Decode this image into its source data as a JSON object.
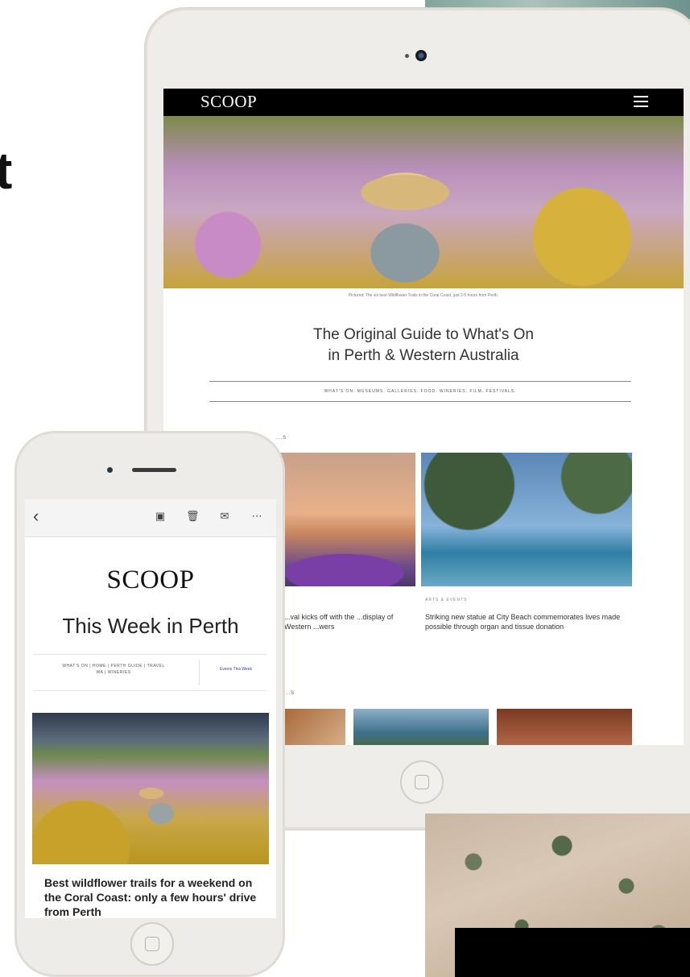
{
  "background": {
    "left_fragment": "t",
    "colors": {
      "ocean": "#7fa59c",
      "sand": "#d8c8b6",
      "black_box": "#000000"
    }
  },
  "tablet": {
    "nav": {
      "logo": "SCOOP",
      "menu_icon": "hamburger-icon"
    },
    "hero_caption": "Pictured: The six best Wildflower Trails in the Coral Coast, just 2-5 hours from Perth.",
    "heading_line1": "The Original Guide to What's On",
    "heading_line2": "in Perth & Western Australia",
    "categories": "WHAT'S ON. MUSEUMS. GALLERIES. FOOD. WINERIES. FILM. FESTIVALS.",
    "section1_label": "...S",
    "articles": [
      {
        "tag": "",
        "text": "...val kicks off with the ...display of Western ...wers"
      },
      {
        "tag": "ARTS & EVENTS",
        "text": "Striking new statue at City Beach commemorates lives made possible through organ and tissue donation"
      }
    ],
    "section2_label": "...S"
  },
  "phone": {
    "toolbar": {
      "back_icon": "chevron-left-icon",
      "icons": [
        "archive-icon",
        "trash-icon",
        "mail-icon",
        "more-icon"
      ]
    },
    "logo": "SCOOP",
    "title": "This Week in Perth",
    "nav_links_line1": "WHAT'S ON  |  HOME  |  PERTH GUIDE  |  TRAVEL",
    "nav_links_line2": "WA  |  WINERIES",
    "events_link": "Events This Week",
    "hero_caption": "Best wildflower trails for a weekend on the Coral Coast: only a few hours' drive from Perth"
  }
}
